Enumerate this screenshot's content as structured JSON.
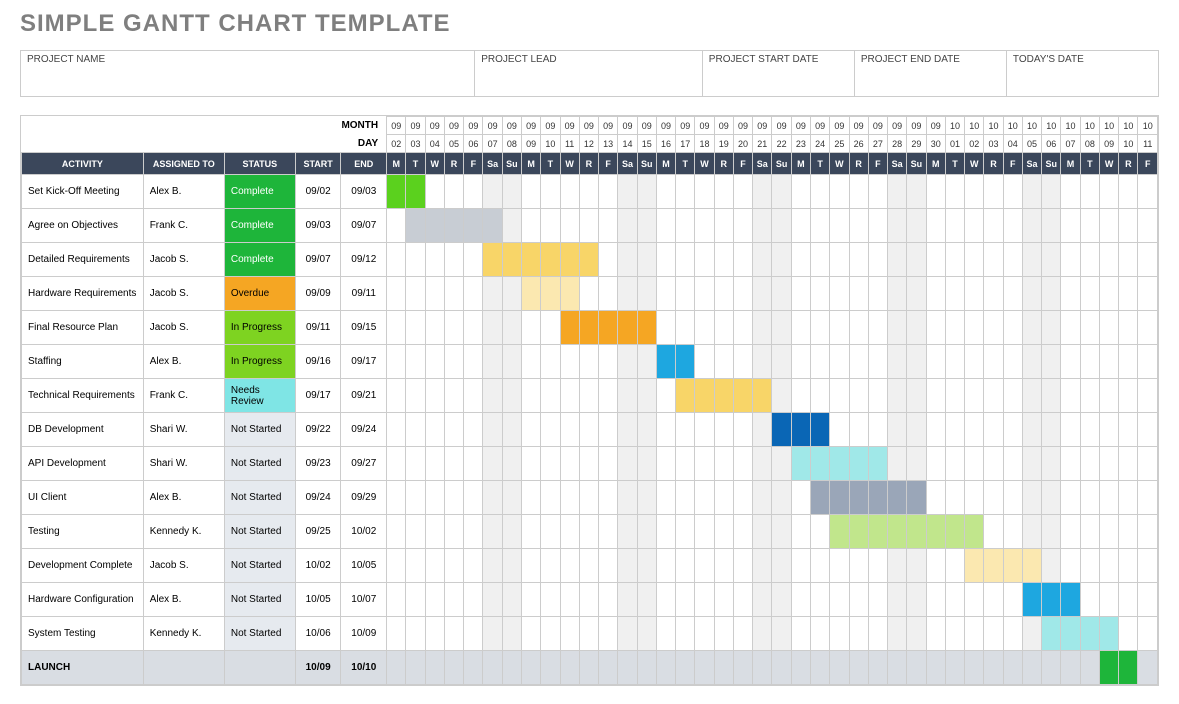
{
  "title": "SIMPLE GANTT CHART TEMPLATE",
  "meta": {
    "project_name_label": "PROJECT NAME",
    "project_lead_label": "PROJECT LEAD",
    "start_date_label": "PROJECT START DATE",
    "end_date_label": "PROJECT END DATE",
    "todays_date_label": "TODAY'S DATE",
    "project_name": "",
    "project_lead": "",
    "start_date": "",
    "end_date": "",
    "todays_date": ""
  },
  "row_labels": {
    "month": "MONTH",
    "day": "DAY"
  },
  "col_headers": {
    "activity": "ACTIVITY",
    "assigned": "ASSIGNED TO",
    "status": "STATUS",
    "start": "START",
    "end": "END"
  },
  "calendar": {
    "months": [
      "09",
      "09",
      "09",
      "09",
      "09",
      "09",
      "09",
      "09",
      "09",
      "09",
      "09",
      "09",
      "09",
      "09",
      "09",
      "09",
      "09",
      "09",
      "09",
      "09",
      "09",
      "09",
      "09",
      "09",
      "09",
      "09",
      "09",
      "09",
      "09",
      "10",
      "10",
      "10",
      "10",
      "10",
      "10",
      "10",
      "10",
      "10",
      "10",
      "10"
    ],
    "days": [
      "02",
      "03",
      "04",
      "05",
      "06",
      "07",
      "08",
      "09",
      "10",
      "11",
      "12",
      "13",
      "14",
      "15",
      "16",
      "17",
      "18",
      "19",
      "20",
      "21",
      "22",
      "23",
      "24",
      "25",
      "26",
      "27",
      "28",
      "29",
      "30",
      "01",
      "02",
      "03",
      "04",
      "05",
      "06",
      "07",
      "08",
      "09",
      "10",
      "11"
    ],
    "dows": [
      "M",
      "T",
      "W",
      "R",
      "F",
      "Sa",
      "Su",
      "M",
      "T",
      "W",
      "R",
      "F",
      "Sa",
      "Su",
      "M",
      "T",
      "W",
      "R",
      "F",
      "Sa",
      "Su",
      "M",
      "T",
      "W",
      "R",
      "F",
      "Sa",
      "Su",
      "M",
      "T",
      "W",
      "R",
      "F",
      "Sa",
      "Su",
      "M",
      "T",
      "W",
      "R",
      "F"
    ]
  },
  "status_colors": {
    "Complete": "status-complete",
    "Overdue": "status-overdue",
    "In Progress": "status-inprogress",
    "Needs Review": "status-needsreview",
    "Not Started": "status-notstarted"
  },
  "tasks": [
    {
      "activity": "Set Kick-Off Meeting",
      "assigned": "Alex B.",
      "status": "Complete",
      "start": "09/02",
      "end": "09/03",
      "bar_start": 0,
      "bar_len": 2,
      "color": "#5bd11e",
      "dim": false
    },
    {
      "activity": "Agree on Objectives",
      "assigned": "Frank C.",
      "status": "Complete",
      "start": "09/03",
      "end": "09/07",
      "bar_start": 1,
      "bar_len": 5,
      "color": "#c8cdd4",
      "dim": false
    },
    {
      "activity": "Detailed Requirements",
      "assigned": "Jacob S.",
      "status": "Complete",
      "start": "09/07",
      "end": "09/12",
      "bar_start": 5,
      "bar_len": 6,
      "color": "#f8d568",
      "dim": false
    },
    {
      "activity": "Hardware Requirements",
      "assigned": "Jacob S.",
      "status": "Overdue",
      "start": "09/09",
      "end": "09/11",
      "bar_start": 7,
      "bar_len": 3,
      "color": "#fbe8b0",
      "dim": false
    },
    {
      "activity": "Final Resource Plan",
      "assigned": "Jacob S.",
      "status": "In Progress",
      "start": "09/11",
      "end": "09/15",
      "bar_start": 9,
      "bar_len": 5,
      "color": "#f5a623",
      "dim": false
    },
    {
      "activity": "Staffing",
      "assigned": "Alex B.",
      "status": "In Progress",
      "start": "09/16",
      "end": "09/17",
      "bar_start": 14,
      "bar_len": 2,
      "color": "#1ea7e0",
      "dim": false
    },
    {
      "activity": "Technical Requirements",
      "assigned": "Frank C.",
      "status": "Needs Review",
      "start": "09/17",
      "end": "09/21",
      "bar_start": 15,
      "bar_len": 5,
      "color": "#f8d568",
      "dim": false
    },
    {
      "activity": "DB Development",
      "assigned": "Shari W.",
      "status": "Not Started",
      "start": "09/22",
      "end": "09/24",
      "bar_start": 20,
      "bar_len": 3,
      "color": "#0a66b5",
      "dim": false
    },
    {
      "activity": "API Development",
      "assigned": "Shari W.",
      "status": "Not Started",
      "start": "09/23",
      "end": "09/27",
      "bar_start": 21,
      "bar_len": 5,
      "color": "#a0e8e8",
      "dim": false
    },
    {
      "activity": "UI Client",
      "assigned": "Alex B.",
      "status": "Not Started",
      "start": "09/24",
      "end": "09/29",
      "bar_start": 22,
      "bar_len": 6,
      "color": "#9aa6b8",
      "dim": false
    },
    {
      "activity": "Testing",
      "assigned": "Kennedy K.",
      "status": "Not Started",
      "start": "09/25",
      "end": "10/02",
      "bar_start": 23,
      "bar_len": 8,
      "color": "#c1e68c",
      "dim": false
    },
    {
      "activity": "Development Complete",
      "assigned": "Jacob S.",
      "status": "Not Started",
      "start": "10/02",
      "end": "10/05",
      "bar_start": 30,
      "bar_len": 4,
      "color": "#fbe8b0",
      "dim": false
    },
    {
      "activity": "Hardware Configuration",
      "assigned": "Alex B.",
      "status": "Not Started",
      "start": "10/05",
      "end": "10/07",
      "bar_start": 33,
      "bar_len": 3,
      "color": "#1ea7e0",
      "dim": false
    },
    {
      "activity": "System Testing",
      "assigned": "Kennedy K.",
      "status": "Not Started",
      "start": "10/06",
      "end": "10/09",
      "bar_start": 34,
      "bar_len": 4,
      "color": "#a0e8e8",
      "dim": false
    },
    {
      "activity": "LAUNCH",
      "assigned": "",
      "status": "",
      "start": "10/09",
      "end": "10/10",
      "bar_start": 37,
      "bar_len": 2,
      "color": "#1eb53a",
      "dim": false,
      "is_launch": true
    }
  ],
  "chart_data": {
    "type": "table",
    "title": "Simple Gantt Chart Template",
    "date_range": {
      "start": "09/02",
      "end": "10/11"
    },
    "columns": [
      "Activity",
      "Assigned To",
      "Status",
      "Start",
      "End"
    ],
    "series": [
      {
        "name": "Set Kick-Off Meeting",
        "assigned": "Alex B.",
        "status": "Complete",
        "start": "09/02",
        "end": "09/03"
      },
      {
        "name": "Agree on Objectives",
        "assigned": "Frank C.",
        "status": "Complete",
        "start": "09/03",
        "end": "09/07"
      },
      {
        "name": "Detailed Requirements",
        "assigned": "Jacob S.",
        "status": "Complete",
        "start": "09/07",
        "end": "09/12"
      },
      {
        "name": "Hardware Requirements",
        "assigned": "Jacob S.",
        "status": "Overdue",
        "start": "09/09",
        "end": "09/11"
      },
      {
        "name": "Final Resource Plan",
        "assigned": "Jacob S.",
        "status": "In Progress",
        "start": "09/11",
        "end": "09/15"
      },
      {
        "name": "Staffing",
        "assigned": "Alex B.",
        "status": "In Progress",
        "start": "09/16",
        "end": "09/17"
      },
      {
        "name": "Technical Requirements",
        "assigned": "Frank C.",
        "status": "Needs Review",
        "start": "09/17",
        "end": "09/21"
      },
      {
        "name": "DB Development",
        "assigned": "Shari W.",
        "status": "Not Started",
        "start": "09/22",
        "end": "09/24"
      },
      {
        "name": "API Development",
        "assigned": "Shari W.",
        "status": "Not Started",
        "start": "09/23",
        "end": "09/27"
      },
      {
        "name": "UI Client",
        "assigned": "Alex B.",
        "status": "Not Started",
        "start": "09/24",
        "end": "09/29"
      },
      {
        "name": "Testing",
        "assigned": "Kennedy K.",
        "status": "Not Started",
        "start": "09/25",
        "end": "10/02"
      },
      {
        "name": "Development Complete",
        "assigned": "Jacob S.",
        "status": "Not Started",
        "start": "10/02",
        "end": "10/05"
      },
      {
        "name": "Hardware Configuration",
        "assigned": "Alex B.",
        "status": "Not Started",
        "start": "10/05",
        "end": "10/07"
      },
      {
        "name": "System Testing",
        "assigned": "Kennedy K.",
        "status": "Not Started",
        "start": "10/06",
        "end": "10/09"
      },
      {
        "name": "LAUNCH",
        "assigned": "",
        "status": "",
        "start": "10/09",
        "end": "10/10"
      }
    ]
  }
}
